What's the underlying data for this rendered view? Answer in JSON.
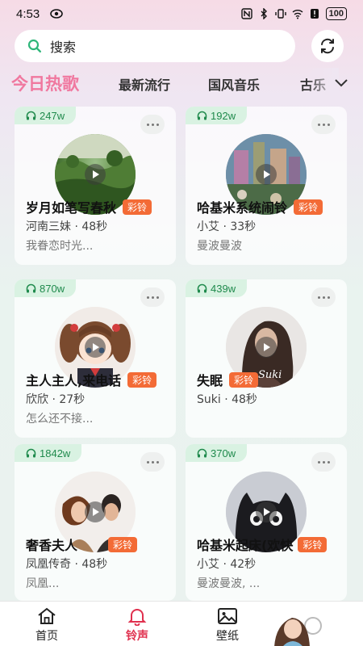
{
  "status": {
    "time": "4:53",
    "battery": "100"
  },
  "search": {
    "placeholder": "搜索"
  },
  "tabs": [
    {
      "label": "今日热歌",
      "active": true
    },
    {
      "label": "最新流行",
      "active": false
    },
    {
      "label": "国风音乐",
      "active": false
    },
    {
      "label": "古乐",
      "active": false
    }
  ],
  "cards": [
    {
      "plays": "247w",
      "title": "岁月如笔写春秋",
      "badge": "彩铃",
      "artist": "河南三妹 · 48秒",
      "desc": "我眷恋时光..."
    },
    {
      "plays": "192w",
      "title": "哈基米系统闹铃",
      "badge": "彩铃",
      "artist": "小艾 · 33秒",
      "desc": "曼波曼波"
    },
    {
      "plays": "870w",
      "title": "主人主人,来电话",
      "badge": "彩铃",
      "artist": "欣欣 · 27秒",
      "desc": "怎么还不接..."
    },
    {
      "plays": "439w",
      "title": "失眠",
      "badge": "彩铃",
      "artist": "Suki · 48秒",
      "desc": ""
    },
    {
      "plays": "1842w",
      "title": "奢香夫人",
      "badge": "彩铃",
      "artist": "凤凰传奇 · 48秒",
      "desc": "凤凰..."
    },
    {
      "plays": "370w",
      "title": "哈基米起床(欢快",
      "badge": "彩铃",
      "artist": "小艾 · 42秒",
      "desc": "曼波曼波, ..."
    }
  ],
  "nav": [
    {
      "label": "首页",
      "icon": "home-icon",
      "active": false
    },
    {
      "label": "铃声",
      "icon": "bell-icon",
      "active": true
    },
    {
      "label": "壁纸",
      "icon": "image-icon",
      "active": false
    }
  ],
  "colors": {
    "accent_pink": "#f0789f",
    "badge_orange": "#f36b36",
    "plays_green": "#1f8a4c",
    "nav_active": "#e0304e"
  }
}
